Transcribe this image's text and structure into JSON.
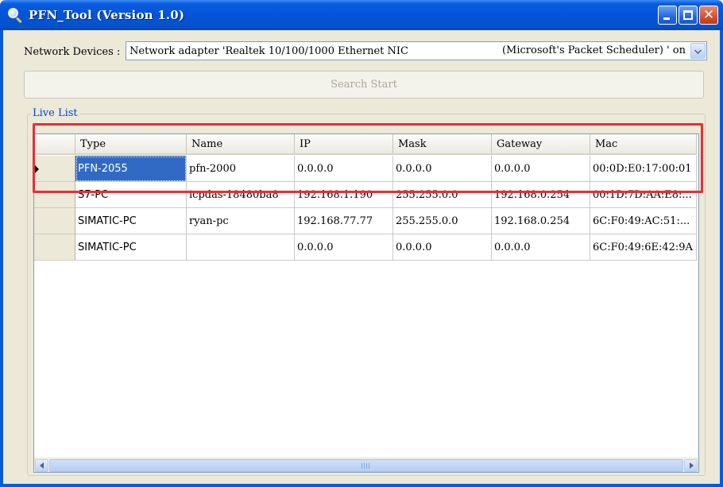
{
  "window": {
    "title": "PFN_Tool (Version 1.0)"
  },
  "network": {
    "label": "Network Devices :",
    "selected_left": "Network adapter 'Realtek 10/100/1000 Ethernet NIC",
    "selected_right": "(Microsoft's Packet Scheduler) ' on"
  },
  "search_button": {
    "label": "Search Start",
    "enabled": false
  },
  "live_list": {
    "legend": "Live List",
    "columns": [
      "Type",
      "Name",
      "IP",
      "Mask",
      "Gateway",
      "Mac"
    ],
    "rows": [
      [
        "PFN-2055",
        "pfn-2000",
        "0.0.0.0",
        "0.0.0.0",
        "0.0.0.0",
        "00:0D:E0:17:00:01"
      ],
      [
        "S7-PC",
        "icpdas-18480ba8",
        "192.168.1.190",
        "255.255.0.0",
        "192.168.0.254",
        "00:1D:7D:AA:E8:..."
      ],
      [
        "SIMATIC-PC",
        "ryan-pc",
        "192.168.77.77",
        "255.255.0.0",
        "192.168.0.254",
        "6C:F0:49:AC:51:..."
      ],
      [
        "SIMATIC-PC",
        "",
        "0.0.0.0",
        "0.0.0.0",
        "0.0.0.0",
        "6C:F0:49:6E:42:9A"
      ]
    ],
    "selected_row": 0
  },
  "colors": {
    "title_bar": "#0454d6",
    "selection": "#316ac5",
    "highlight_box": "#ee2b35",
    "legend_text": "#0046d5"
  },
  "icons": [
    "magnifier-icon",
    "minimize-icon",
    "maximize-icon",
    "close-icon",
    "chevron-down-icon",
    "arrow-left-icon",
    "arrow-right-icon"
  ]
}
